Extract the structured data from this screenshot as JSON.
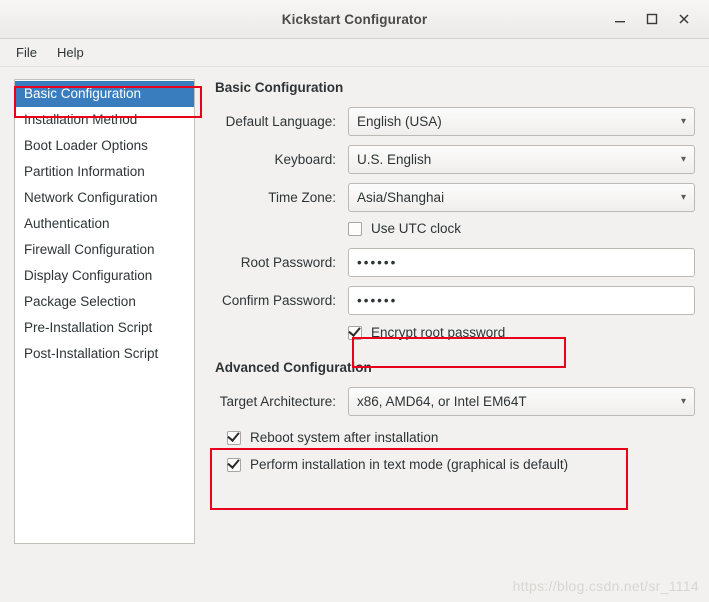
{
  "window": {
    "title": "Kickstart Configurator",
    "buttons": {
      "minimize": "minimize-icon",
      "maximize": "maximize-icon",
      "close": "close-icon"
    }
  },
  "menubar": {
    "items": [
      {
        "label": "File"
      },
      {
        "label": "Help"
      }
    ]
  },
  "sidebar": {
    "items": [
      {
        "label": "Basic Configuration",
        "selected": true
      },
      {
        "label": "Installation Method",
        "selected": false
      },
      {
        "label": "Boot Loader Options",
        "selected": false
      },
      {
        "label": "Partition Information",
        "selected": false
      },
      {
        "label": "Network Configuration",
        "selected": false
      },
      {
        "label": "Authentication",
        "selected": false
      },
      {
        "label": "Firewall Configuration",
        "selected": false
      },
      {
        "label": "Display Configuration",
        "selected": false
      },
      {
        "label": "Package Selection",
        "selected": false
      },
      {
        "label": "Pre-Installation Script",
        "selected": false
      },
      {
        "label": "Post-Installation Script",
        "selected": false
      }
    ]
  },
  "panel": {
    "basic_title": "Basic Configuration",
    "fields": {
      "language_label": "Default Language:",
      "language_value": "English (USA)",
      "keyboard_label": "Keyboard:",
      "keyboard_value": "U.S. English",
      "timezone_label": "Time Zone:",
      "timezone_value": "Asia/Shanghai",
      "utc_label": "Use UTC clock",
      "utc_checked": false,
      "root_password_label": "Root Password:",
      "root_password_value": "••••••",
      "confirm_password_label": "Confirm Password:",
      "confirm_password_value": "••••••",
      "encrypt_label": "Encrypt root password",
      "encrypt_checked": true
    },
    "advanced_title": "Advanced Configuration",
    "advanced": {
      "arch_label": "Target Architecture:",
      "arch_value": "x86, AMD64, or Intel EM64T",
      "reboot_label": "Reboot system after installation",
      "reboot_checked": true,
      "textmode_label": "Perform installation in text mode (graphical is default)",
      "textmode_checked": true
    }
  },
  "watermark": "https://blog.csdn.net/sr_1114",
  "colors": {
    "accent": "#3a7dbe",
    "annotation": "#e8001c",
    "window_bg": "#f2f1f0"
  }
}
